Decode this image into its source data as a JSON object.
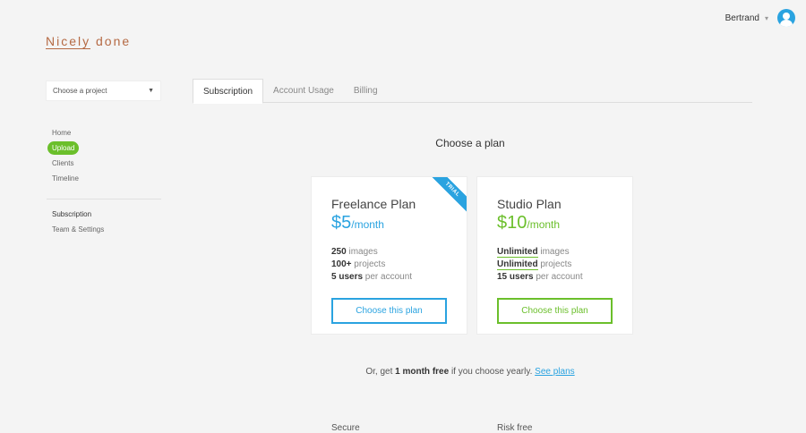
{
  "user": {
    "name": "Bertrand",
    "caret": "▾"
  },
  "logo": {
    "part1": "Nicely",
    "part2": " done"
  },
  "project_select": {
    "value": "Choose a project",
    "arrow": "▼"
  },
  "sidebar": {
    "items": [
      {
        "label": "Home"
      },
      {
        "label": "Upload"
      },
      {
        "label": "Clients"
      },
      {
        "label": "Timeline"
      }
    ],
    "settings": [
      {
        "label": "Subscription"
      },
      {
        "label": "Team & Settings"
      }
    ]
  },
  "tabs": [
    {
      "label": "Subscription"
    },
    {
      "label": "Account Usage"
    },
    {
      "label": "Billing"
    }
  ],
  "heading": "Choose a plan",
  "plans": [
    {
      "name": "Freelance Plan",
      "price": "$5",
      "per": "/month",
      "ribbon": "TRIAL",
      "features": [
        {
          "value": "250",
          "label": " images"
        },
        {
          "value": "100+",
          "label": " projects"
        },
        {
          "value": "5 users",
          "label": " per account"
        }
      ],
      "cta": "Choose this plan"
    },
    {
      "name": "Studio Plan",
      "price": "$10",
      "per": "/month",
      "features": [
        {
          "value": "Unlimited",
          "label": " images"
        },
        {
          "value": "Unlimited",
          "label": " projects"
        },
        {
          "value": "15 users",
          "label": " per account"
        }
      ],
      "cta": "Choose this plan"
    }
  ],
  "yearly": {
    "prefix": "Or, get ",
    "bold": "1 month free",
    "middle": " if you choose yearly. ",
    "link": "See plans"
  },
  "bottom": {
    "left": "Secure",
    "right": "Risk free"
  },
  "colors": {
    "blue": "#2aa3e0",
    "green": "#6bbf2b",
    "logo": "#b56a44"
  }
}
